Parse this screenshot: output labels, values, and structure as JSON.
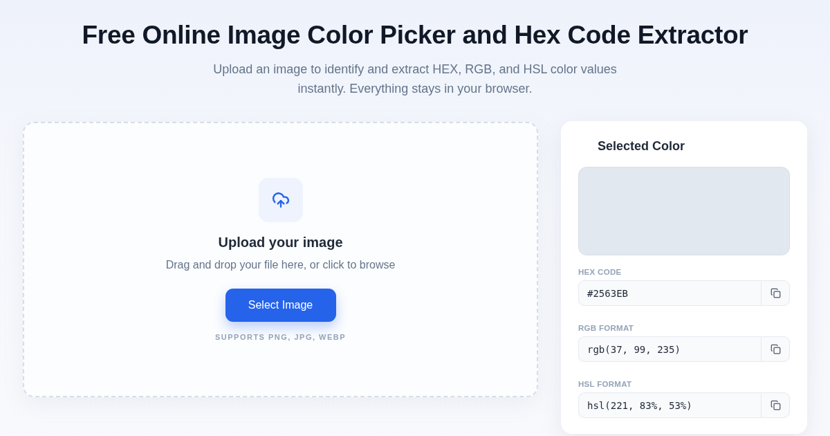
{
  "header": {
    "title": "Free Online Image Color Picker and Hex Code Extractor",
    "subtitle": "Upload an image to identify and extract HEX, RGB, and HSL color values instantly. Everything stays in your browser."
  },
  "upload": {
    "heading": "Upload your image",
    "hint": "Drag and drop your file here, or click to browse",
    "button": "Select Image",
    "formats": "SUPPORTS PNG, JPG, WEBP"
  },
  "selected_color": {
    "title": "Selected Color",
    "fields": [
      {
        "label": "HEX CODE",
        "value": "#2563EB"
      },
      {
        "label": "RGB FORMAT",
        "value": "rgb(37, 99, 235)"
      },
      {
        "label": "HSL FORMAT",
        "value": "hsl(221, 83%, 53%)"
      }
    ]
  }
}
